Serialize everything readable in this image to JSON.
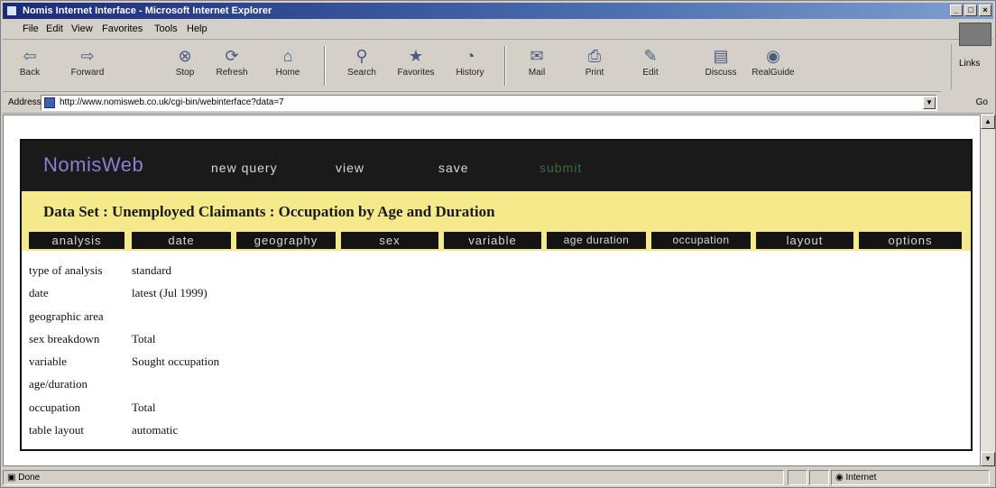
{
  "window": {
    "title": "Nomis Internet Interface - Microsoft Internet Explorer",
    "buttons": [
      "_",
      "□",
      "×"
    ]
  },
  "menu": [
    "File",
    "Edit",
    "View",
    "Favorites",
    "Tools",
    "Help"
  ],
  "toolbar": {
    "buttons": [
      {
        "label": "Back",
        "icon": "back-arrow-icon",
        "glyph": "⇦"
      },
      {
        "label": "Forward",
        "icon": "forward-arrow-icon",
        "glyph": "⇨"
      },
      {
        "label": "Stop",
        "icon": "stop-icon",
        "glyph": "⊗"
      },
      {
        "label": "Refresh",
        "icon": "refresh-icon",
        "glyph": "⟳"
      },
      {
        "label": "Home",
        "icon": "home-icon",
        "glyph": "⌂"
      },
      {
        "label": "Search",
        "icon": "search-icon",
        "glyph": "⚲"
      },
      {
        "label": "Favorites",
        "icon": "favorites-icon",
        "glyph": "★"
      },
      {
        "label": "History",
        "icon": "history-icon",
        "glyph": "◔"
      },
      {
        "label": "Mail",
        "icon": "mail-icon",
        "glyph": "✉"
      },
      {
        "label": "Print",
        "icon": "print-icon",
        "glyph": "⎙"
      },
      {
        "label": "Edit",
        "icon": "edit-icon",
        "glyph": "✎"
      },
      {
        "label": "Discuss",
        "icon": "discuss-icon",
        "glyph": "▤"
      },
      {
        "label": "RealGuide",
        "icon": "realguide-icon",
        "glyph": "◉"
      }
    ],
    "links_label": "Links"
  },
  "address": {
    "label": "Address",
    "url": "http://www.nomisweb.co.uk/cgi-bin/webinterface?data=7",
    "go_label": "Go"
  },
  "app": {
    "brand": "NomisWeb",
    "nav": [
      "new query",
      "view",
      "save",
      "submit"
    ],
    "dataset_title": "Data Set : Unemployed Claimants : Occupation by Age and Duration",
    "tabs": [
      "analysis",
      "date",
      "geography",
      "sex",
      "variable",
      "age duration",
      "occupation",
      "layout",
      "options"
    ],
    "details": [
      {
        "label": "type of analysis",
        "value": "standard"
      },
      {
        "label": "date",
        "value": "latest (Jul 1999)"
      },
      {
        "label": "geographic area",
        "value": ""
      },
      {
        "label": "sex breakdown",
        "value": "Total"
      },
      {
        "label": "variable",
        "value": "Sought occupation"
      },
      {
        "label": "age/duration",
        "value": ""
      },
      {
        "label": "occupation",
        "value": "Total"
      },
      {
        "label": "table layout",
        "value": "automatic"
      }
    ]
  },
  "status": {
    "text": "Done",
    "zone": "Internet"
  },
  "colors": {
    "nav_bg": "#1a1a1a",
    "brand": "#8a7fd0",
    "dataset_bar": "#f4ea8a",
    "submit": "#3d6b3d"
  }
}
